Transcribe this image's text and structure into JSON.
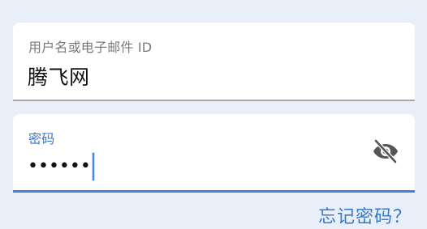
{
  "username": {
    "label": "用户名或电子邮件 ID",
    "value": "腾飞网"
  },
  "password": {
    "label": "密码",
    "masked_value": "••••••",
    "toggle_icon": "eye-off-icon"
  },
  "forgot_password": {
    "label": "忘记密码？"
  },
  "colors": {
    "background": "#e9eff8",
    "accent": "#3a78c8",
    "field_bg": "#ffffff"
  }
}
